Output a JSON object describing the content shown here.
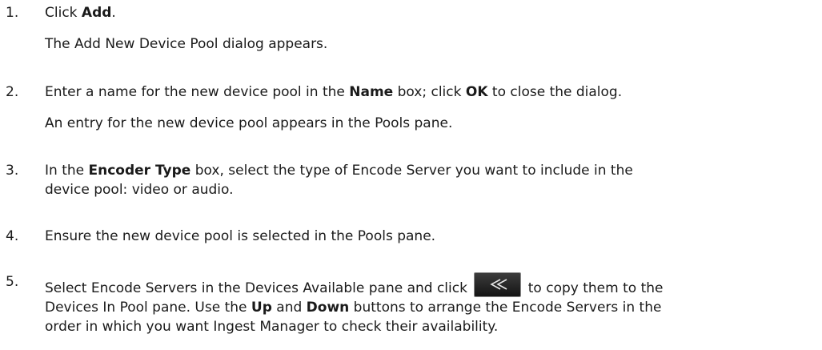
{
  "steps": [
    {
      "number": "1.",
      "prefix": "Click ",
      "bold1": "Add",
      "suffix": ".",
      "note": "The Add New Device Pool dialog appears."
    },
    {
      "number": "2.",
      "prefix": "Enter a name for the new device pool in the ",
      "bold1": "Name",
      "mid": " box; click ",
      "bold2": "OK",
      "suffix": " to close the dialog.",
      "note": "An entry for the new device pool appears in the Pools pane."
    },
    {
      "number": "3.",
      "line1_prefix": "In the ",
      "bold1": "Encoder Type",
      "line1_suffix": " box, select the type of Encode Server you want to include in the",
      "line2": "device pool: video or audio."
    },
    {
      "number": "4.",
      "text": "Ensure the new device pool is selected in the Pools pane."
    },
    {
      "number": "5.",
      "line1_prefix": "Select Encode Servers in the Devices Available pane and click ",
      "line1_suffix": " to copy them to the",
      "line2_prefix": "Devices In Pool pane. Use the ",
      "bold1": "Up",
      "line2_mid": " and ",
      "bold2": "Down",
      "line2_suffix": " buttons to arrange the Encode Servers in the",
      "line3": "order in which you want Ingest Manager to check their availability.",
      "icon": "double-left-arrow-icon"
    }
  ]
}
